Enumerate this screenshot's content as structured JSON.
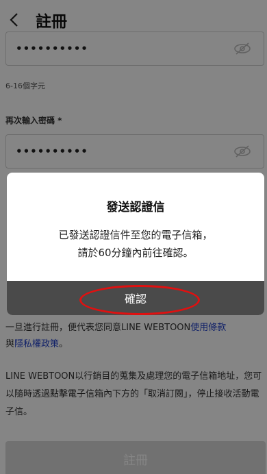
{
  "header": {
    "title": "註冊"
  },
  "password_field": {
    "value": "••••••••••"
  },
  "password_hint": "6-16個字元",
  "confirm_label": "再次輸入密碼 *",
  "confirm_field": {
    "value": "••••••••••"
  },
  "terms": {
    "prefix": "一旦進行註冊，便代表您同意LINE WEBTOON",
    "terms_link": "使用條款",
    "middle": "與",
    "privacy_link": "隱私權政策",
    "suffix": "。"
  },
  "marketing_text": "LINE WEBTOON以行銷目的蒐集及處理您的電子信箱地址，您可以隨時透過點擊電子信箱內下方的「取消訂閱」，停止接收活動電子信。",
  "register_button": "註冊",
  "dialog": {
    "title": "發送認證信",
    "message_line1": "已發送認證信件至您的電子信箱，",
    "message_line2": "請於60分鐘內前往確認。",
    "confirm_button": "確認"
  },
  "colors": {
    "link": "#1f3fc8",
    "annotation": "#e01010"
  }
}
